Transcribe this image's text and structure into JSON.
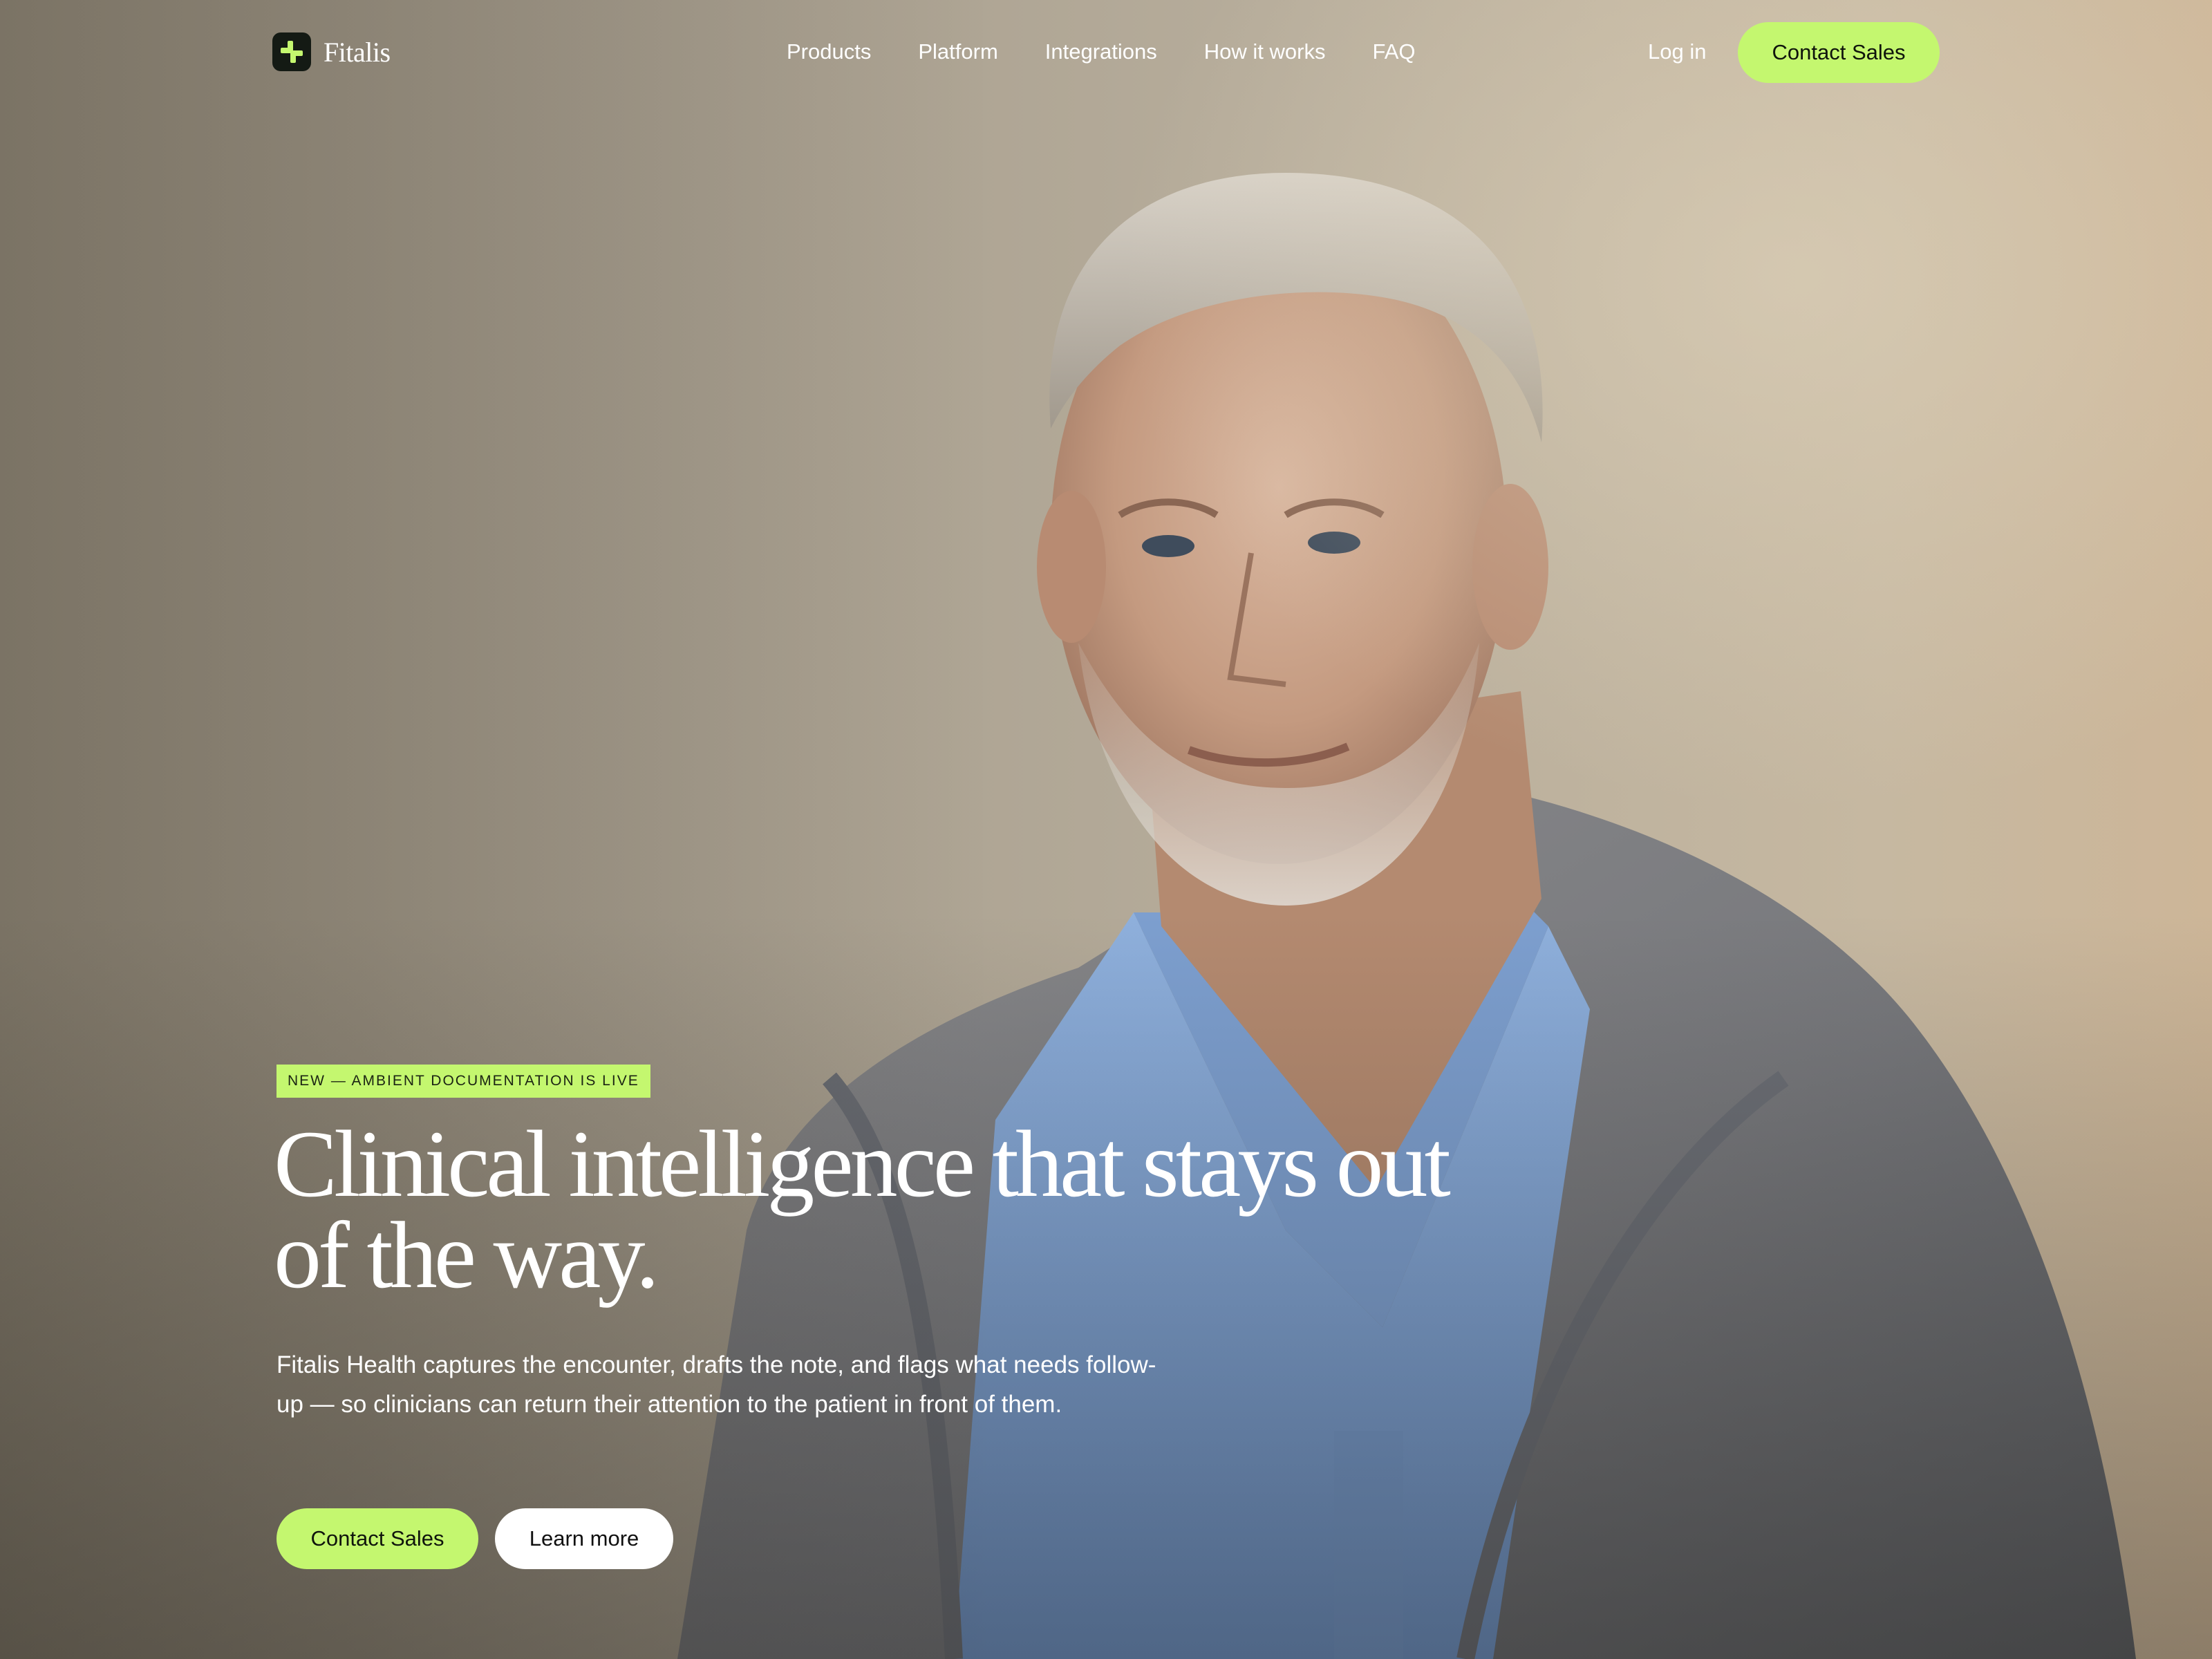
{
  "brand": {
    "name": "Fitalis",
    "accent_color": "#c4f76f",
    "logo_mark_color": "#141a14"
  },
  "nav": {
    "links": [
      "Products",
      "Platform",
      "Integrations",
      "How it works",
      "FAQ"
    ],
    "login_label": "Log in",
    "cta_label": "Contact Sales"
  },
  "hero": {
    "badge": "NEW — AMBIENT DOCUMENTATION IS LIVE",
    "headline": "Clinical intelligence that stays out of the way.",
    "subheadline": "Fitalis Health captures the encounter, drafts the note, and flags what needs follow-up — so clinicians can return their attention to the patient in front of them.",
    "primary_cta": "Contact Sales",
    "secondary_cta": "Learn more",
    "background_image": "photo of a smiling grey-haired clinician in blue scrubs and a grey fleece jacket"
  }
}
